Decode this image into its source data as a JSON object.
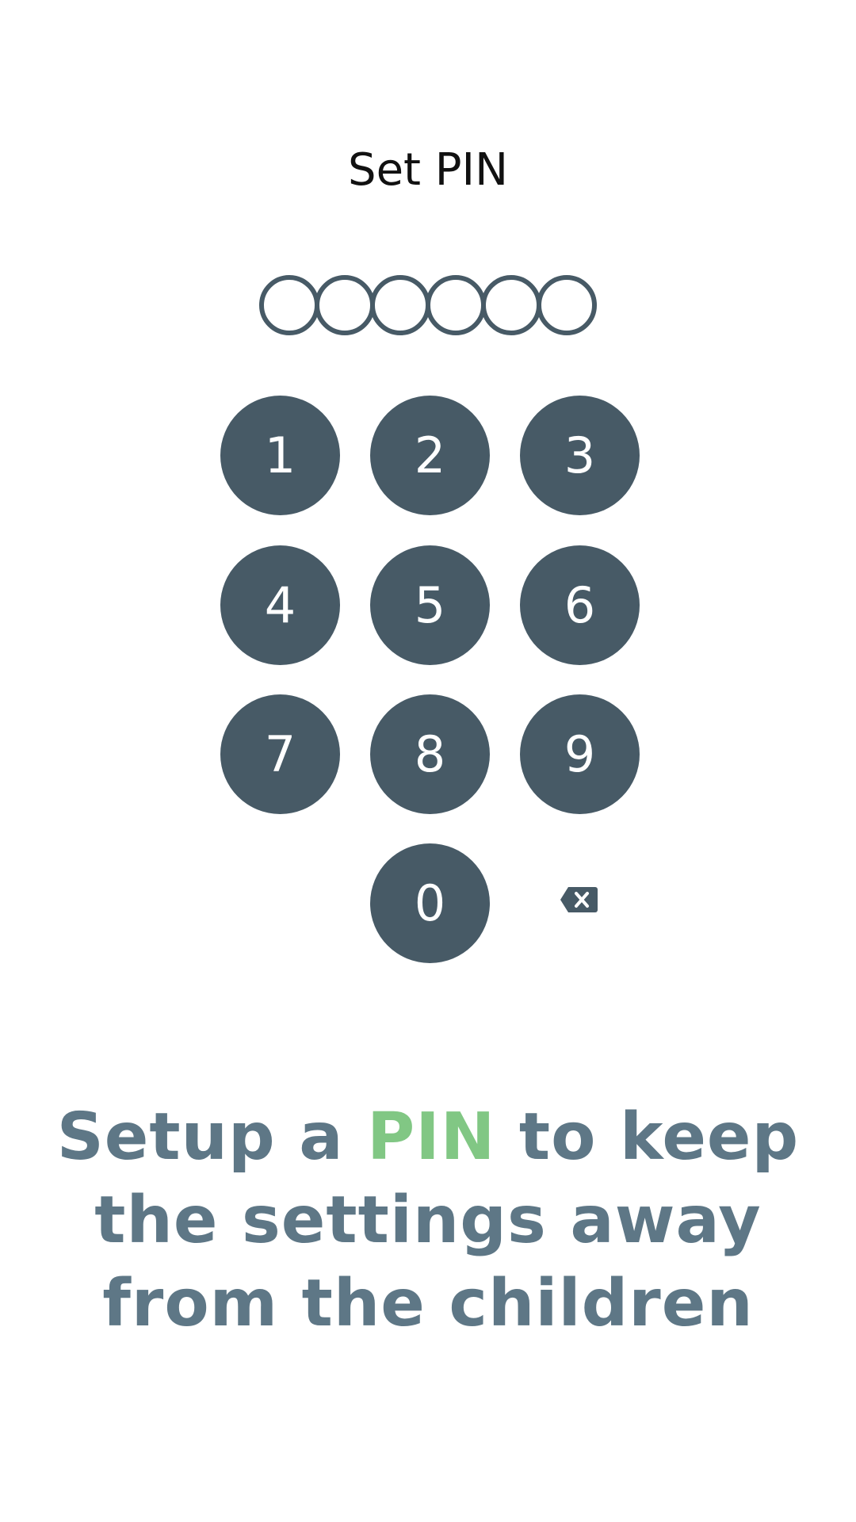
{
  "title": "Set PIN",
  "pin": {
    "length": 6,
    "filled": 0
  },
  "keypad": {
    "keys": [
      "1",
      "2",
      "3",
      "4",
      "5",
      "6",
      "7",
      "8",
      "9",
      "0"
    ],
    "backspace_icon": "backspace-icon"
  },
  "message": {
    "part1": "Setup a ",
    "accent": "PIN",
    "part2": " to keep the settings away from the children"
  },
  "colors": {
    "key_background": "#475a66",
    "message_text": "#5e7786",
    "accent": "#81c784"
  }
}
